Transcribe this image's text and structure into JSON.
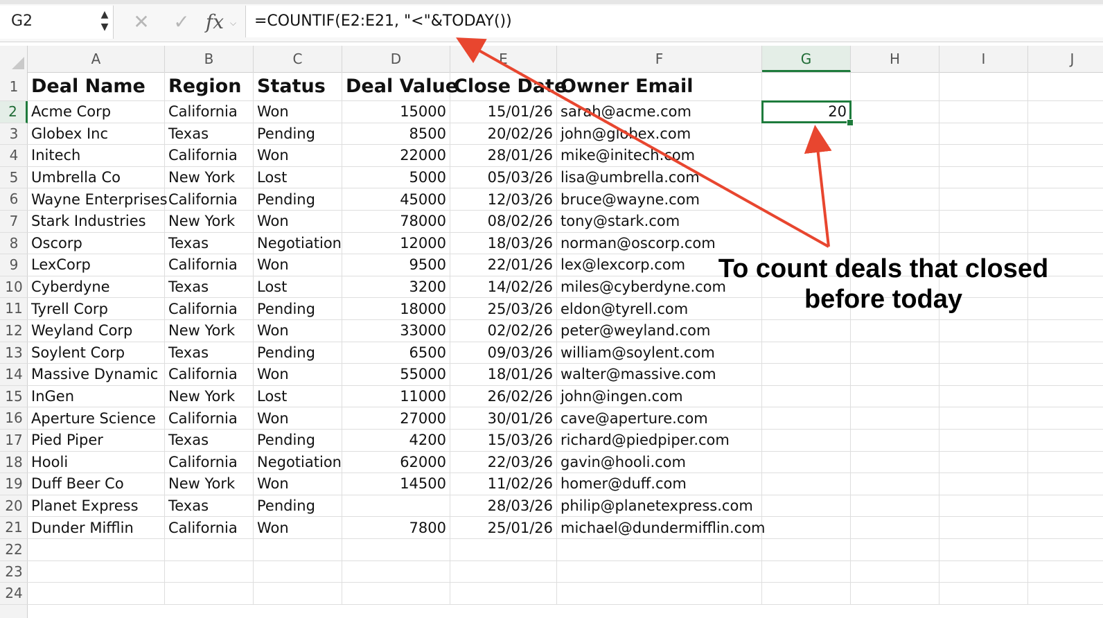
{
  "name_box": {
    "value": "G2"
  },
  "formula_bar": {
    "cancel_glyph": "✕",
    "enter_glyph": "✓",
    "fx_label": "fx",
    "formula": "=COUNTIF(E2:E21, \"<\"&TODAY())"
  },
  "columns": [
    "A",
    "B",
    "C",
    "D",
    "E",
    "F",
    "G",
    "H",
    "I",
    "J"
  ],
  "selected_column": "G",
  "selected_row": "2",
  "row_numbers": [
    "1",
    "2",
    "3",
    "4",
    "5",
    "6",
    "7",
    "8",
    "9",
    "10",
    "11",
    "12",
    "13",
    "14",
    "15",
    "16",
    "17",
    "18",
    "19",
    "20",
    "21",
    "22",
    "23",
    "24"
  ],
  "table": {
    "headers": [
      "Deal Name",
      "Region",
      "Status",
      "Deal Value",
      "Close Date",
      "Owner Email"
    ],
    "rows": [
      [
        "Acme Corp",
        "California",
        "Won",
        "15000",
        "15/01/26",
        "sarah@acme.com"
      ],
      [
        "Globex Inc",
        "Texas",
        "Pending",
        "8500",
        "20/02/26",
        "john@globex.com"
      ],
      [
        "Initech",
        "California",
        "Won",
        "22000",
        "28/01/26",
        "mike@initech.com"
      ],
      [
        "Umbrella Co",
        "New York",
        "Lost",
        "5000",
        "05/03/26",
        "lisa@umbrella.com"
      ],
      [
        "Wayne Enterprises",
        "California",
        "Pending",
        "45000",
        "12/03/26",
        "bruce@wayne.com"
      ],
      [
        "Stark Industries",
        "New York",
        "Won",
        "78000",
        "08/02/26",
        "tony@stark.com"
      ],
      [
        "Oscorp",
        "Texas",
        "Negotiation",
        "12000",
        "18/03/26",
        "norman@oscorp.com"
      ],
      [
        "LexCorp",
        "California",
        "Won",
        "9500",
        "22/01/26",
        "lex@lexcorp.com"
      ],
      [
        "Cyberdyne",
        "Texas",
        "Lost",
        "3200",
        "14/02/26",
        "miles@cyberdyne.com"
      ],
      [
        "Tyrell Corp",
        "California",
        "Pending",
        "18000",
        "25/03/26",
        "eldon@tyrell.com"
      ],
      [
        "Weyland Corp",
        "New York",
        "Won",
        "33000",
        "02/02/26",
        "peter@weyland.com"
      ],
      [
        "Soylent Corp",
        "Texas",
        "Pending",
        "6500",
        "09/03/26",
        "william@soylent.com"
      ],
      [
        "Massive Dynamic",
        "California",
        "Won",
        "55000",
        "18/01/26",
        "walter@massive.com"
      ],
      [
        "InGen",
        "New York",
        "Lost",
        "11000",
        "26/02/26",
        "john@ingen.com"
      ],
      [
        "Aperture Science",
        "California",
        "Won",
        "27000",
        "30/01/26",
        "cave@aperture.com"
      ],
      [
        "Pied Piper",
        "Texas",
        "Pending",
        "4200",
        "15/03/26",
        "richard@piedpiper.com"
      ],
      [
        "Hooli",
        "California",
        "Negotiation",
        "62000",
        "22/03/26",
        "gavin@hooli.com"
      ],
      [
        "Duff Beer Co",
        "New York",
        "Won",
        "14500",
        "11/02/26",
        "homer@duff.com"
      ],
      [
        "Planet Express",
        "Texas",
        "Pending",
        "",
        "28/03/26",
        "philip@planetexpress.com"
      ],
      [
        "Dunder Mifflin",
        "California",
        "Won",
        "7800",
        "25/01/26",
        "michael@dundermifflin.com"
      ]
    ]
  },
  "result_cell": {
    "ref": "G2",
    "value": "20"
  },
  "annotation": {
    "text_line1": "To count deals that closed",
    "text_line2": "before today",
    "arrow_color": "#e8462f"
  },
  "colors": {
    "selection_green": "#1e7b3c",
    "header_bg": "#f3f3f3",
    "gridline": "#dedede"
  }
}
